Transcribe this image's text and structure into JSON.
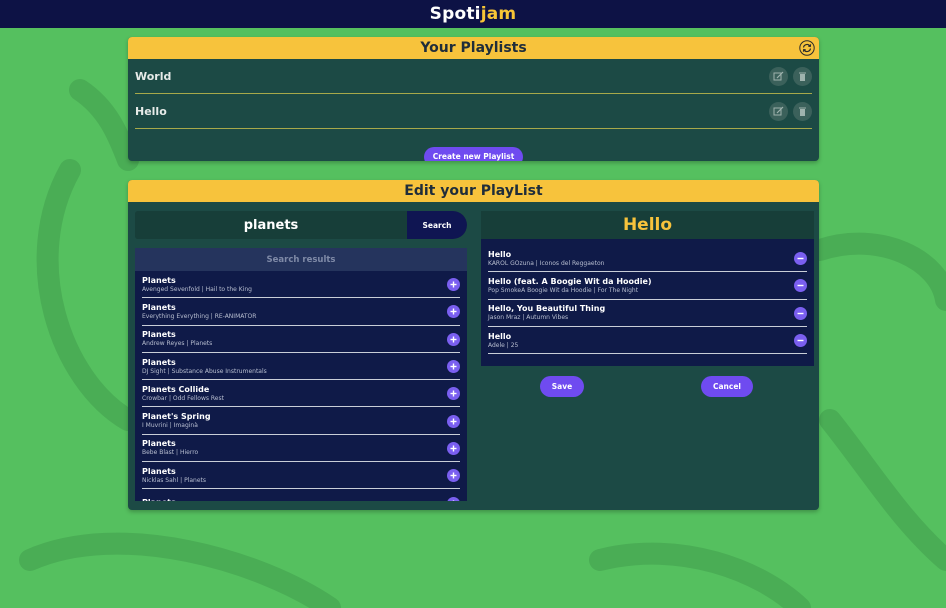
{
  "brand": {
    "name_main": "Spoti",
    "name_accent": "jam"
  },
  "playlists_panel": {
    "title": "Your Playlists",
    "refresh_icon": "refresh-icon",
    "items": [
      {
        "name": "World"
      },
      {
        "name": "Hello"
      }
    ],
    "edit_icon": "edit-icon",
    "delete_icon": "trash-icon",
    "create_label": "Create new Playlist"
  },
  "edit_panel": {
    "title": "Edit your PlayList",
    "search": {
      "value": "planets",
      "button_label": "Search"
    },
    "results": {
      "header": "Search results",
      "items": [
        {
          "title": "Planets",
          "sub": "Avenged Sevenfold | Hail to the King"
        },
        {
          "title": "Planets",
          "sub": "Everything Everything | RE-ANIMATOR"
        },
        {
          "title": "Planets",
          "sub": "Andrew Reyes | Planets"
        },
        {
          "title": "Planets",
          "sub": "DJ Sight | Substance Abuse Instrumentals"
        },
        {
          "title": "Planets Collide",
          "sub": "Crowbar | Odd Fellows Rest"
        },
        {
          "title": "Planet's Spring",
          "sub": "I Muvrini | Imaginà"
        },
        {
          "title": "Planets",
          "sub": "Bebe Blast | Hierro"
        },
        {
          "title": "Planets",
          "sub": "Nicklas Sahl | Planets"
        },
        {
          "title": "Planets",
          "sub": ""
        }
      ]
    },
    "playlist": {
      "name": "Hello",
      "tracks": [
        {
          "title": "Hello",
          "sub": "KAROL GOzuna | Iconos del Reggaeton"
        },
        {
          "title": "Hello (feat. A Boogie Wit da Hoodie)",
          "sub": "Pop SmokeA Boogie Wit da Hoodie | For The Night"
        },
        {
          "title": "Hello, You Beautiful Thing",
          "sub": "Jason Mraz | Autumn Vibes"
        },
        {
          "title": "Hello",
          "sub": "Adele | 25"
        }
      ]
    },
    "save_label": "Save",
    "cancel_label": "Cancel"
  },
  "colors": {
    "background": "#55c05f",
    "navbar": "#0d1245",
    "accent_yellow": "#f7c33c",
    "panel": "#1c4a45",
    "list_bg": "#0f1a48",
    "button_purple": "#6f4bf0"
  }
}
